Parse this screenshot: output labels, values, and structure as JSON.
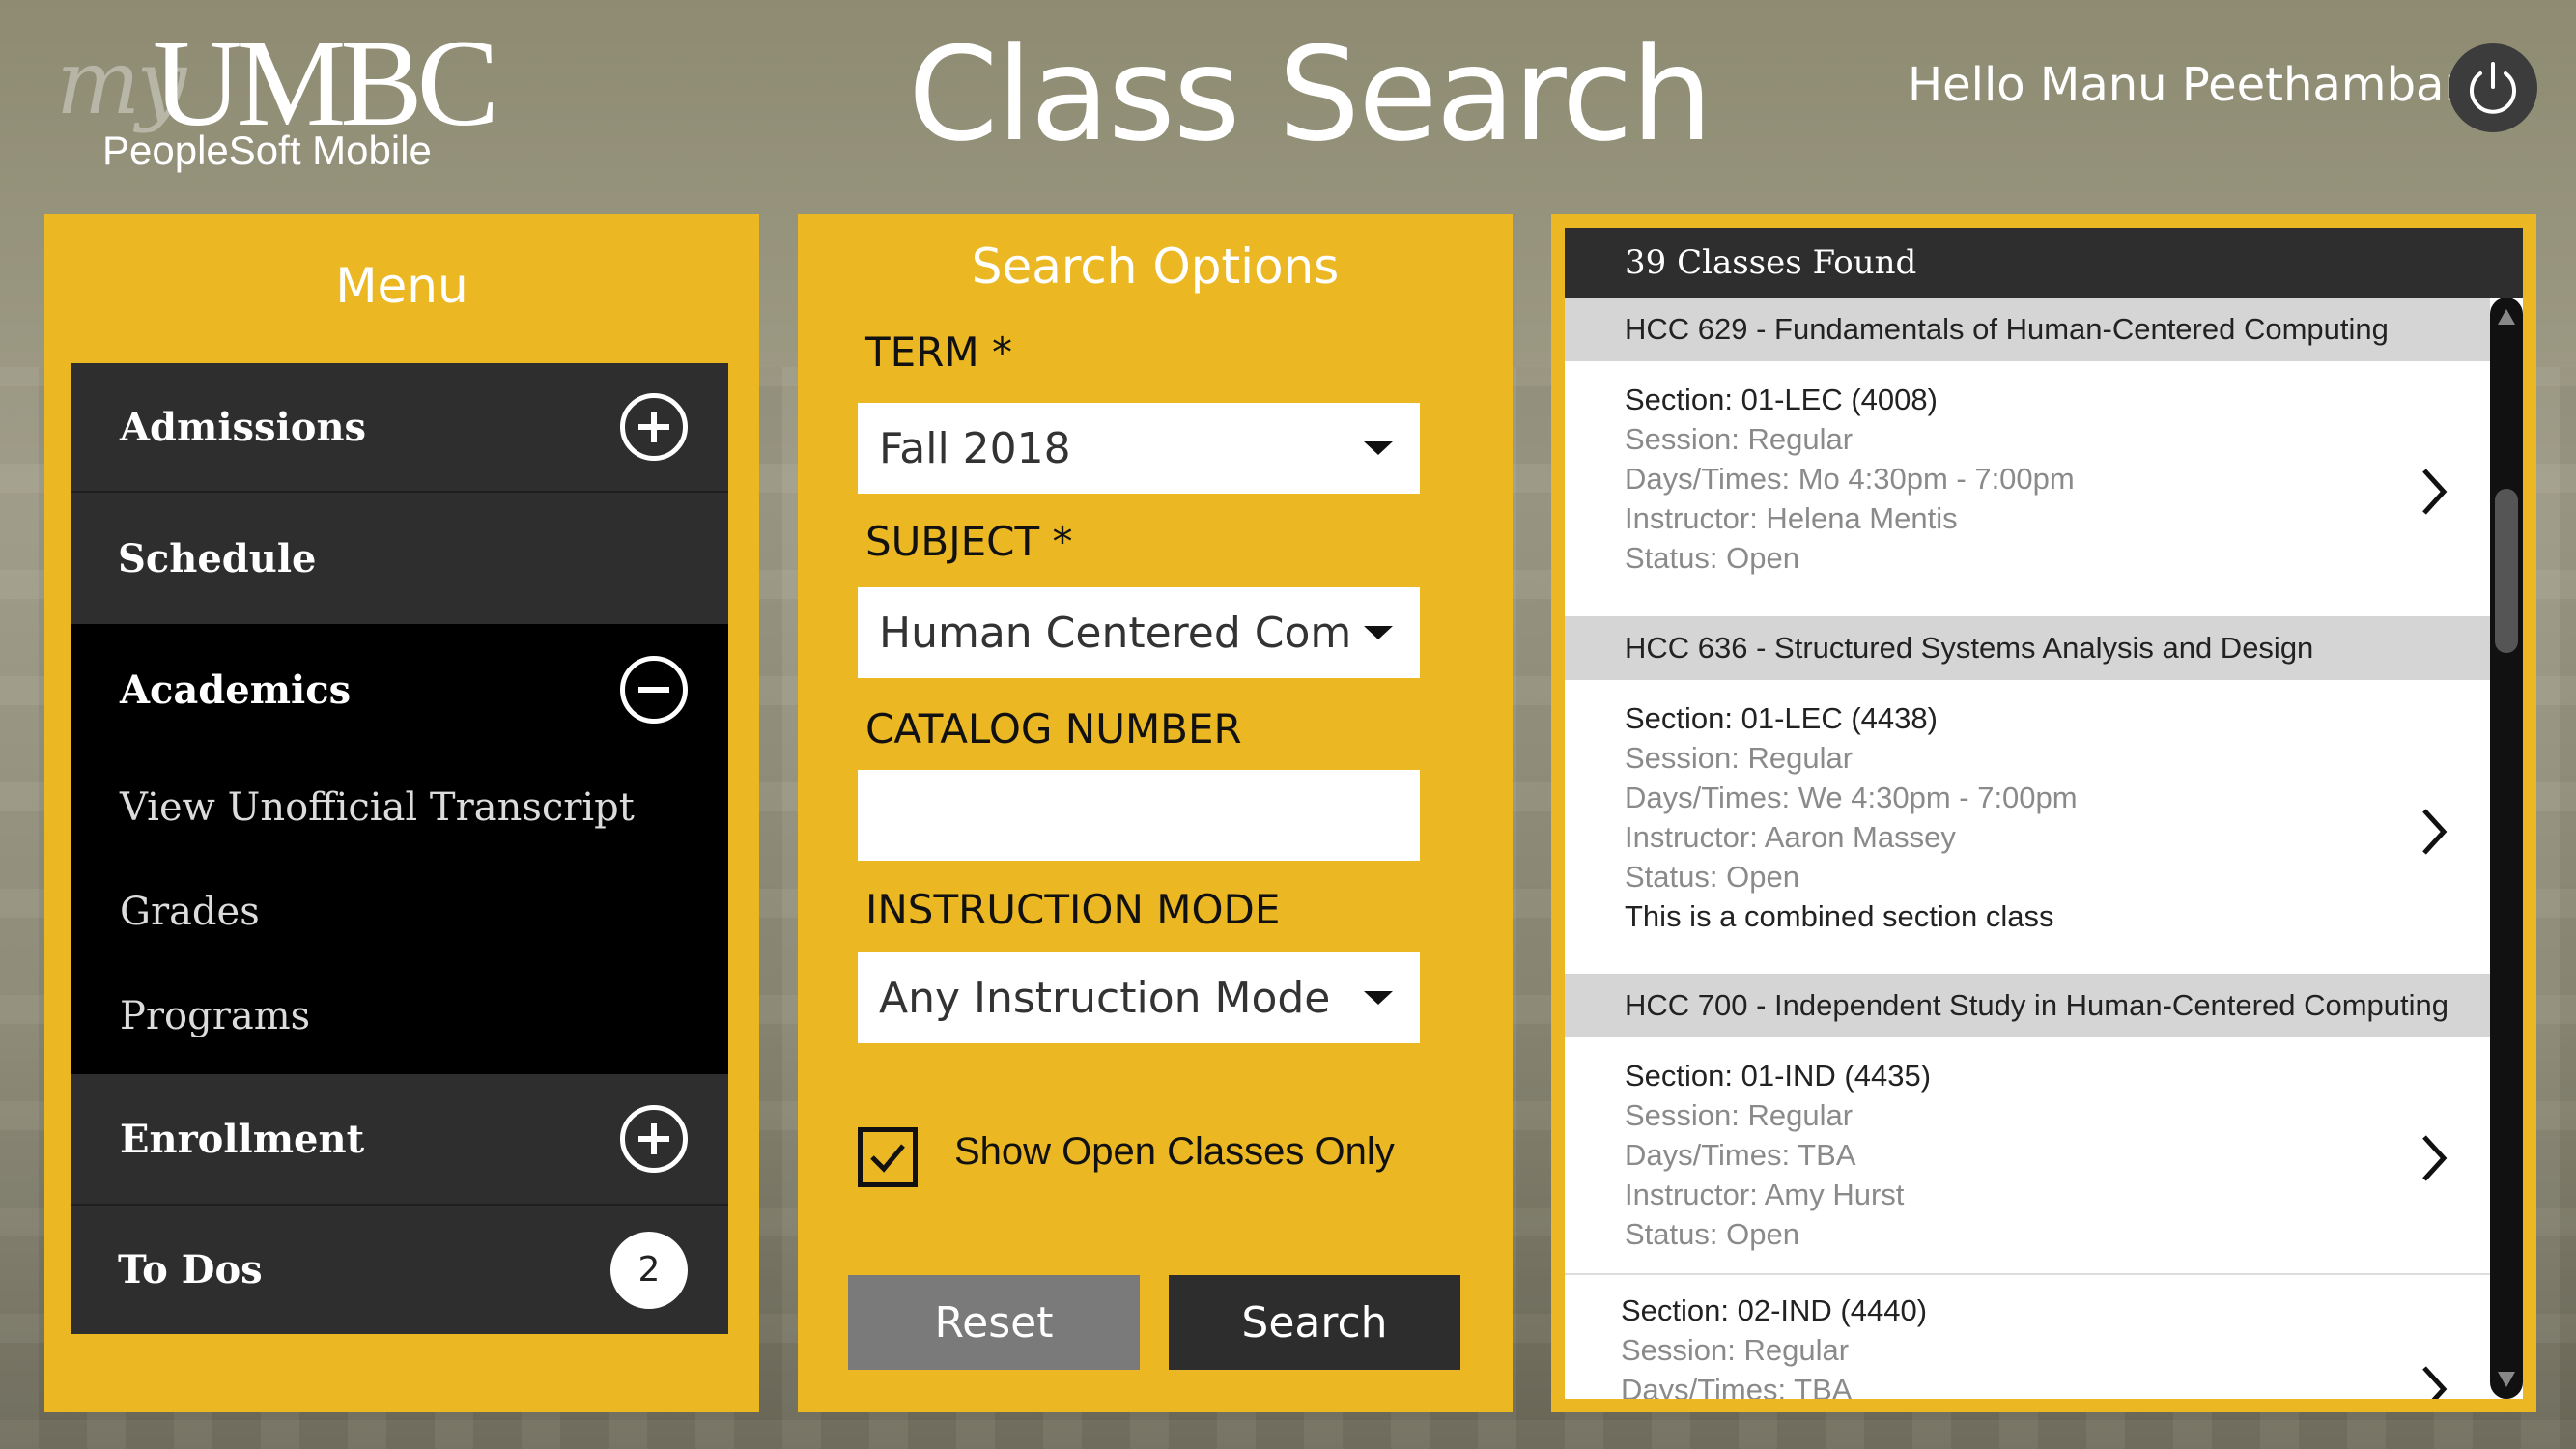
{
  "header": {
    "logo_my": "my",
    "logo_umbc": "UMBC",
    "logo_sub": "PeopleSoft Mobile",
    "title": "Class Search",
    "greeting": "Hello Manu Peethambar"
  },
  "menu": {
    "title": "Menu",
    "items": [
      {
        "label": "Admissions",
        "icon": "plus-circle-icon"
      },
      {
        "label": "Schedule"
      },
      {
        "label": "Academics",
        "icon": "minus-circle-icon"
      },
      {
        "label": "View Unofficial Transcript"
      },
      {
        "label": "Grades"
      },
      {
        "label": "Programs"
      },
      {
        "label": "Enrollment",
        "icon": "plus-circle-icon"
      },
      {
        "label": "To Dos",
        "badge": "2"
      }
    ]
  },
  "search": {
    "title": "Search Options",
    "term_label": "TERM *",
    "term_value": "Fall 2018",
    "subject_label": "SUBJECT *",
    "subject_value": "Human Centered Comp..",
    "catalog_label": "CATALOG NUMBER",
    "catalog_value": "",
    "mode_label": "INSTRUCTION MODE",
    "mode_value": "Any Instruction Mode",
    "open_only_label": "Show Open Classes Only",
    "open_only_checked": true,
    "reset_label": "Reset",
    "search_label": "Search"
  },
  "results": {
    "count_label": "39 Classes Found",
    "courses": [
      {
        "title": "HCC 629 - Fundamentals of Human-Centered Computing",
        "sections": [
          {
            "section": "Section: 01-LEC (4008)",
            "session": "Session: Regular",
            "days": "Days/Times: Mo 4:30pm - 7:00pm",
            "instructor": "Instructor: Helena Mentis",
            "status": "Status: Open"
          }
        ]
      },
      {
        "title": "HCC 636 - Structured Systems Analysis and Design",
        "sections": [
          {
            "section": "Section: 01-LEC (4438)",
            "session": "Session: Regular",
            "days": "Days/Times: We 4:30pm - 7:00pm",
            "instructor": "Instructor: Aaron Massey",
            "status": "Status: Open",
            "note": "This is a combined section class"
          }
        ]
      },
      {
        "title": "HCC 700 - Independent Study in Human-Centered Computing",
        "sections": [
          {
            "section": "Section: 01-IND (4435)",
            "session": "Session: Regular",
            "days": "Days/Times: TBA",
            "instructor": "Instructor: Amy Hurst",
            "status": "Status: Open"
          },
          {
            "section": "Section: 02-IND (4440)",
            "session": "Session: Regular",
            "days": "Days/Times: TBA"
          }
        ]
      }
    ]
  },
  "colors": {
    "accent_gold": "#ebb823",
    "menu_black": "#000000",
    "menu_dark": "#2e2e2e"
  }
}
